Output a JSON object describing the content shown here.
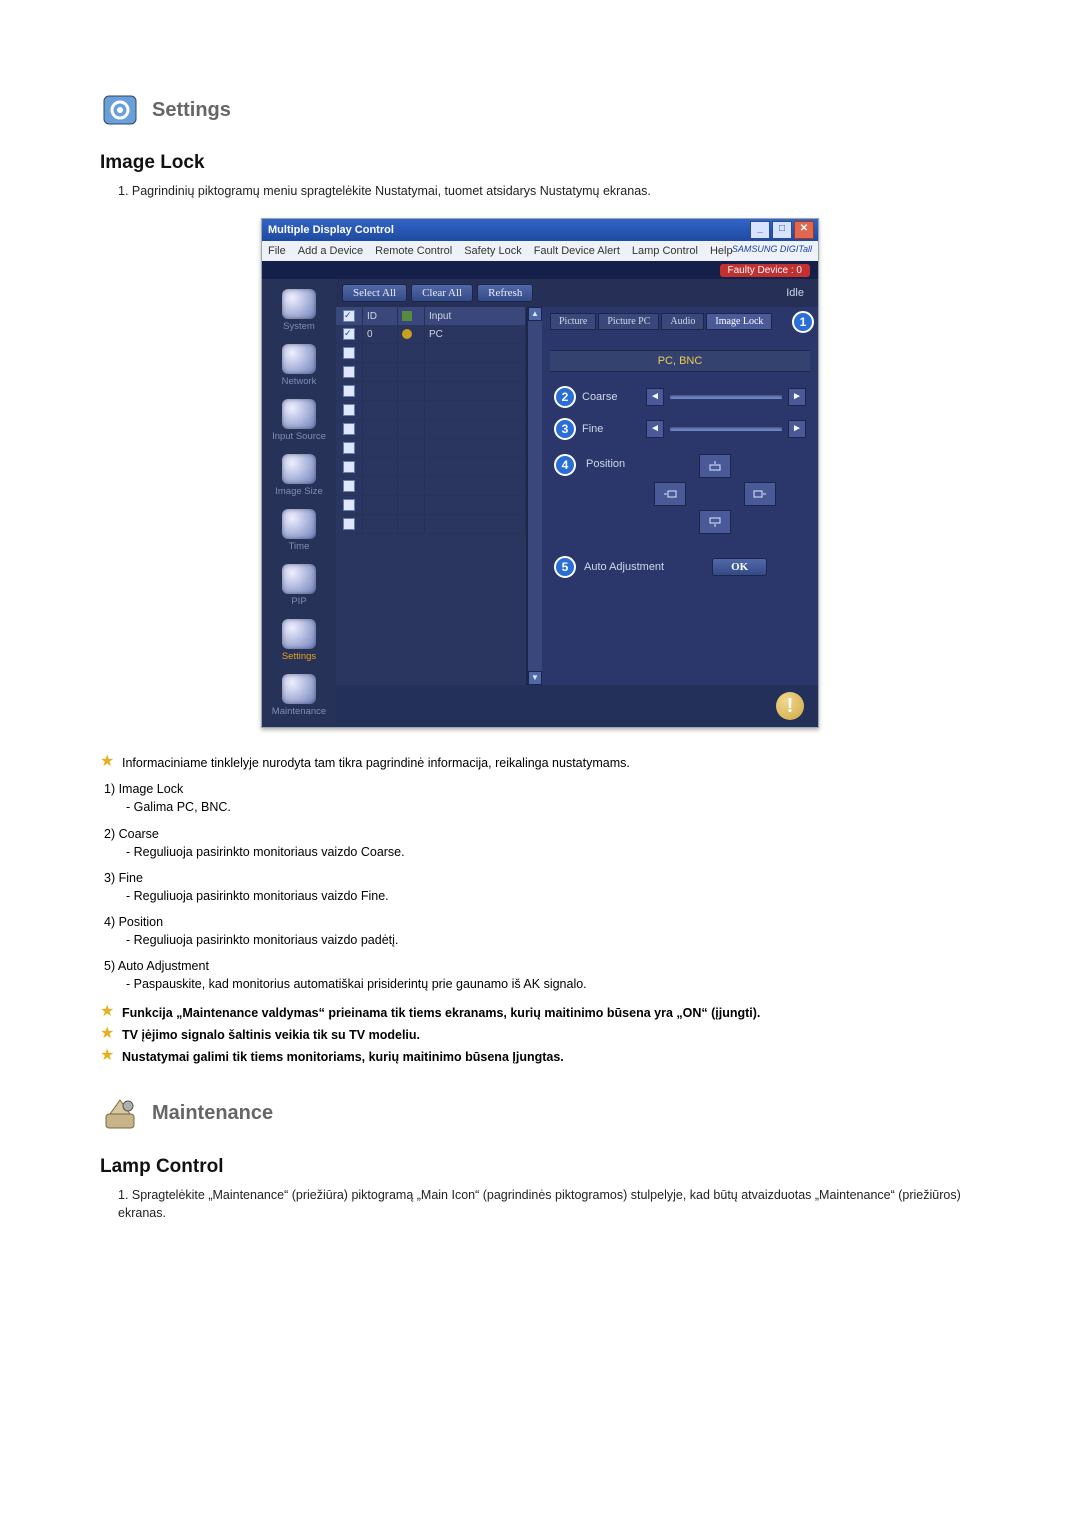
{
  "section1": {
    "title": "Settings",
    "subtitle": "Image Lock",
    "intro": "1.  Pagrindinių piktogramų meniu spragtelėkite Nustatymai, tuomet atsidarys Nustatymų ekranas."
  },
  "shot": {
    "title": "Multiple Display Control",
    "menus": [
      "File",
      "Add a Device",
      "Remote Control",
      "Safety Lock",
      "Fault Device Alert",
      "Lamp Control",
      "Help"
    ],
    "brand": "SAMSUNG DIGITall",
    "fault": "Faulty Device : 0",
    "buttons": {
      "selectAll": "Select All",
      "clearAll": "Clear All",
      "refresh": "Refresh"
    },
    "idle": "Idle",
    "sidebar": [
      {
        "label": "System"
      },
      {
        "label": "Network"
      },
      {
        "label": "Input Source"
      },
      {
        "label": "Image Size"
      },
      {
        "label": "Time"
      },
      {
        "label": "PIP"
      },
      {
        "label": "Settings",
        "active": true
      },
      {
        "label": "Maintenance"
      }
    ],
    "grid": {
      "headers": {
        "id": "ID",
        "input": "Input"
      },
      "row": {
        "id": "0",
        "input": "PC"
      }
    },
    "tabs": [
      "Picture",
      "Picture PC",
      "Audio",
      "Image Lock"
    ],
    "activeTab": "Image Lock",
    "band": "PC, BNC",
    "labels": {
      "coarse": "Coarse",
      "fine": "Fine",
      "position": "Position",
      "auto": "Auto Adjustment",
      "ok": "OK"
    }
  },
  "notes": {
    "star1": "Informaciniame tinklelyje nurodyta tam tikra pagrindinė informacija, reikalinga nustatymams.",
    "items": [
      {
        "head": "1)  Image Lock",
        "sub": "- Galima PC, BNC."
      },
      {
        "head": "2)  Coarse",
        "sub": "- Reguliuoja pasirinkto monitoriaus vaizdo Coarse."
      },
      {
        "head": "3)  Fine",
        "sub": "- Reguliuoja pasirinkto monitoriaus vaizdo Fine."
      },
      {
        "head": "4)  Position",
        "sub": "- Reguliuoja pasirinkto monitoriaus vaizdo padėtį."
      },
      {
        "head": "5)  Auto Adjustment",
        "sub": "- Paspauskite, kad monitorius automatiškai prisiderintų prie gaunamo iš AK signalo."
      }
    ],
    "starBold": [
      "Funkcija „Maintenance valdymas“ prieinama tik tiems ekranams, kurių maitinimo būsena yra „ON“ (įjungti).",
      "TV įėjimo signalo šaltinis veikia tik su TV modeliu.",
      "Nustatymai galimi tik tiems monitoriams, kurių maitinimo būsena Įjungtas."
    ]
  },
  "section2": {
    "title": "Maintenance",
    "subtitle": "Lamp Control",
    "list1": "1.  Spragtelėkite „Maintenance“ (priežiūra) piktogramą „Main Icon“ (pagrindinės piktogramos) stulpelyje, kad būtų atvaizduotas „Maintenance“ (priežiūros) ekranas."
  }
}
